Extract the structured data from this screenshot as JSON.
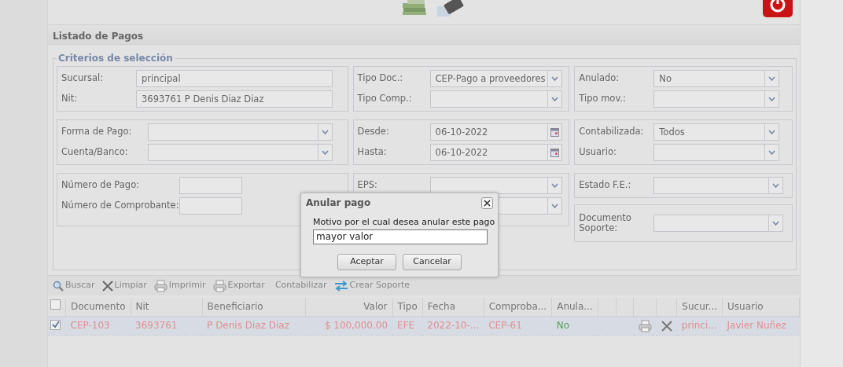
{
  "panel_title": "Listado de Pagos",
  "criteria": {
    "legend": "Criterios de selección",
    "rows": [
      {
        "groups": [
          {
            "kind": "group",
            "fields": [
              {
                "label": "Sucursal:",
                "kind": "text",
                "value": "principal"
              },
              {
                "label": "Nit:",
                "kind": "text",
                "value": "3693761 P Denis Diaz Diaz"
              }
            ]
          },
          {
            "kind": "group",
            "fields": [
              {
                "label": "Tipo Doc.:",
                "kind": "select",
                "value": "CEP-Pago a proveedores"
              },
              {
                "label": "Tipo Comp.:",
                "kind": "select"
              }
            ]
          },
          {
            "kind": "group",
            "fields": [
              {
                "label": "Anulado:",
                "kind": "select",
                "value": "No"
              },
              {
                "label": "Tipo mov.:",
                "kind": "select"
              }
            ]
          }
        ]
      },
      {
        "groups": [
          {
            "kind": "group",
            "fields": [
              {
                "label": "Forma de Pago:",
                "kind": "select"
              },
              {
                "label": "Cuenta/Banco:",
                "kind": "select"
              }
            ]
          },
          {
            "kind": "group",
            "fields": [
              {
                "label": "Desde:",
                "kind": "date",
                "value": "06-10-2022"
              },
              {
                "label": "Hasta:",
                "kind": "date",
                "value": "06-10-2022"
              }
            ]
          },
          {
            "kind": "group",
            "fields": [
              {
                "label": "Contabilizada:",
                "kind": "select",
                "value": "Todos"
              },
              {
                "label": "Usuario:",
                "kind": "select"
              }
            ]
          }
        ]
      },
      {
        "groups": [
          {
            "kind": "group",
            "fields": [
              {
                "label": "Número de Pago:",
                "kind": "text"
              },
              {
                "label": "Número de Comprobante:",
                "kind": "text"
              }
            ]
          },
          {
            "kind": "group",
            "fields": [
              {
                "label": "EPS:",
                "kind": "select"
              },
              {
                "kind": "select"
              }
            ]
          },
          {
            "kind": "stack",
            "groups": [
              {
                "kind": "group",
                "fields": [
                  {
                    "label": "Estado F.E.:",
                    "kind": "select"
                  }
                ]
              },
              {
                "kind": "group",
                "fields": [
                  {
                    "label": "Documento Soporte:",
                    "kind": "select"
                  }
                ]
              }
            ]
          }
        ]
      }
    ]
  },
  "toolbar": [
    {
      "label": "Buscar",
      "kind": "search"
    },
    {
      "label": "Limpiar",
      "kind": "clear"
    },
    {
      "label": "Imprimir",
      "kind": "print"
    },
    {
      "label": "Exportar",
      "kind": "print"
    },
    {
      "label": "Contabilizar",
      "kind": "plain"
    },
    {
      "label": "Crear Soporte",
      "kind": "swap"
    }
  ],
  "table": {
    "columns": [
      {
        "kind": "check",
        "checked": false
      },
      {
        "label": "Documento"
      },
      {
        "label": "Nit"
      },
      {
        "label": "Beneficiario"
      },
      {
        "label": "Valor"
      },
      {
        "label": "Tipo"
      },
      {
        "label": "Fecha"
      },
      {
        "label": "Comproba..."
      },
      {
        "label": "Anula..."
      },
      {
        "kind": "blank"
      },
      {
        "kind": "blank"
      },
      {
        "kind": "blank"
      },
      {
        "kind": "blank"
      },
      {
        "label": "Sucur..."
      },
      {
        "label": "Usuario"
      }
    ],
    "rows": [
      {
        "selected": true,
        "cells": [
          {
            "kind": "check",
            "checked": true
          },
          {
            "text": "CEP-103"
          },
          {
            "text": "3693761"
          },
          {
            "text": "P Denis Diaz Diaz"
          },
          {
            "text": "$ 100,000.00"
          },
          {
            "text": "EFE"
          },
          {
            "text": "2022-10-..."
          },
          {
            "text": "CEP-61"
          },
          {
            "text": "No",
            "kind": "status"
          },
          {
            "kind": "empty"
          },
          {
            "kind": "empty"
          },
          {
            "kind": "print"
          },
          {
            "kind": "delete"
          },
          {
            "text": "princi..."
          },
          {
            "text": "Javier Nuñez"
          }
        ]
      }
    ]
  },
  "dialog": {
    "title": "Anular pago",
    "prompt": "Motivo por el cual desea anular este pago",
    "value": "mayor valor",
    "buttons": [
      "Aceptar",
      "Cancelar"
    ]
  }
}
